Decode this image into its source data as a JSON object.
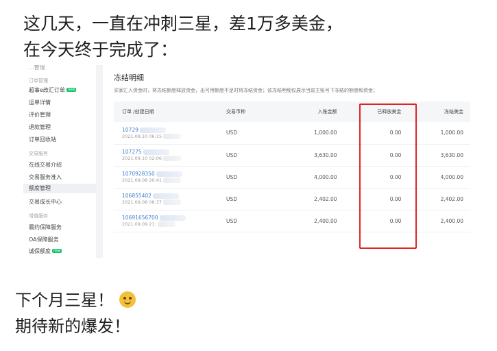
{
  "post": {
    "line1": "这几天，一直在冲刺三星，差1万多美金，",
    "line2": "在今天终于完成了：",
    "footer_line1": "下个月三星！",
    "footer_emoji": "thinking-face-emoji",
    "footer_line2": "期待新的爆发！"
  },
  "sidebar": {
    "top_cut": "...管理",
    "sections": [
      {
        "title": "订单管理",
        "items": [
          {
            "label": "超事e改汇订单",
            "badge": "new"
          },
          {
            "label": "运单详情"
          },
          {
            "label": "评价管理"
          },
          {
            "label": "退款管理"
          },
          {
            "label": "订单回收站"
          }
        ]
      },
      {
        "title": "交易服务",
        "items": [
          {
            "label": "在线交易介绍"
          },
          {
            "label": "交易服务准入"
          },
          {
            "label": "额度管理",
            "active": true
          },
          {
            "label": "交易成长中心"
          }
        ]
      },
      {
        "title": "增值服务",
        "items": [
          {
            "label": "履约保障服务"
          },
          {
            "label": "OA保障服务"
          },
          {
            "label": "诚保额度",
            "badge": "new"
          }
        ]
      }
    ]
  },
  "main": {
    "title": "冻结明细",
    "description": "买家汇入资金时，将冻结额度释放资金，出可用额度不足时将冻结资金；该冻结明细仅展示当前主账号下冻结的额度和资金；",
    "columns": [
      "订单 /创建日期",
      "交易币种",
      "入账金额",
      "已释放美金",
      "冻结美金"
    ],
    "rows": [
      {
        "order": "10729",
        "date": "2021.09.10 06:15",
        "currency": "USD",
        "amount": "1,000.00",
        "released": "0.00",
        "frozen": "1,000.00"
      },
      {
        "order": "107275",
        "date": "2021.09.10 02:06",
        "currency": "USD",
        "amount": "3,630.00",
        "released": "0.00",
        "frozen": "3,630.00"
      },
      {
        "order": "1070928350",
        "date": "2021.09.08 20:41",
        "currency": "USD",
        "amount": "4,000.00",
        "released": "0.00",
        "frozen": "4,000.00"
      },
      {
        "order": "106855402",
        "date": "2021.09.08 08:37",
        "currency": "USD",
        "amount": "2,402.00",
        "released": "0.00",
        "frozen": "2,402.00"
      },
      {
        "order": "10691656700",
        "date": "2021.09.09 21:",
        "currency": "USD",
        "amount": "2,400.00",
        "released": "0.00",
        "frozen": "2,400.00"
      }
    ]
  },
  "colors": {
    "highlight": "#e02424",
    "link": "#3f7fd1",
    "badge": "#18c26f"
  }
}
